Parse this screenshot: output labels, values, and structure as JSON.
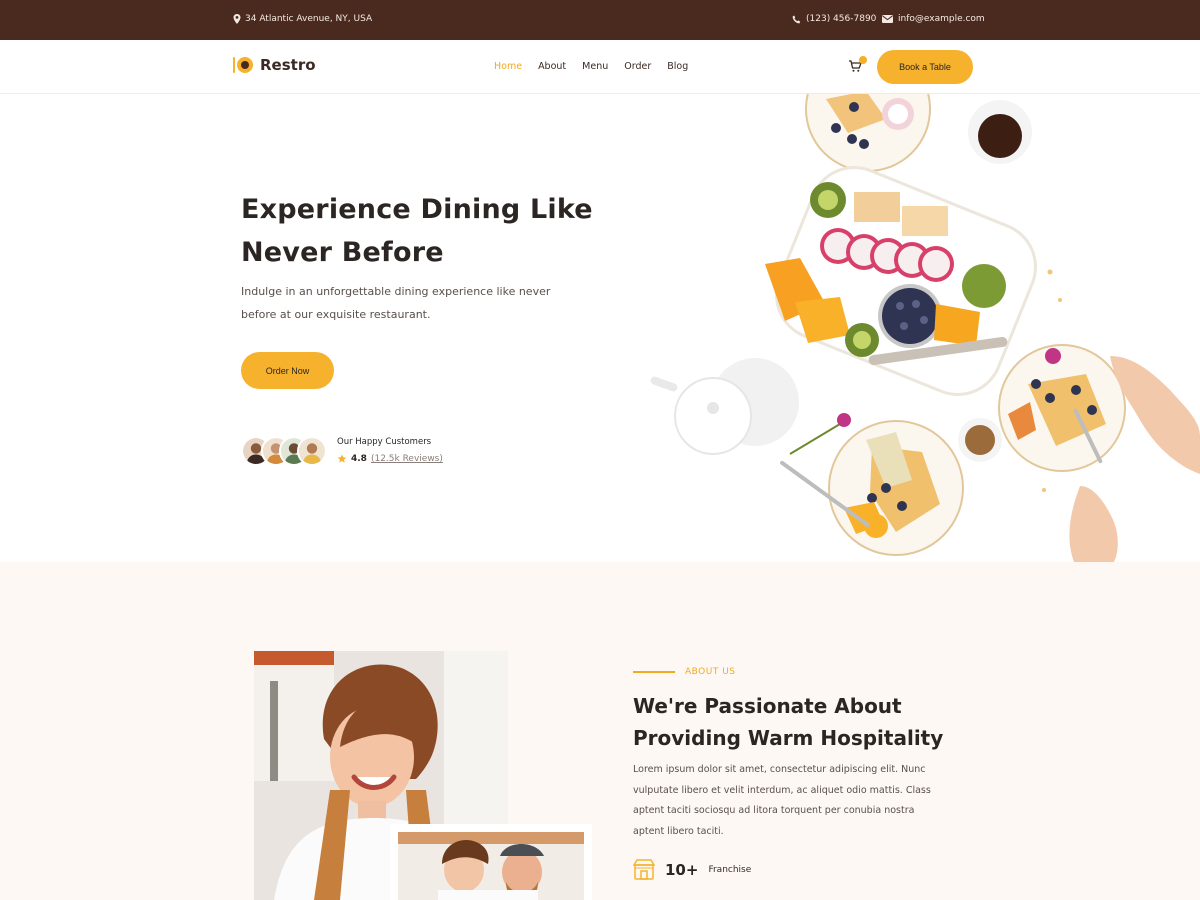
{
  "topbar": {
    "address": "34 Atlantic Avenue, NY, USA",
    "phone": "(123) 456-7890",
    "email": "info@example.com"
  },
  "header": {
    "logo_text": "Restro",
    "nav": [
      "Home",
      "About",
      "Menu",
      "Order",
      "Blog"
    ],
    "active_nav": "Home",
    "cta_label": "Book a Table"
  },
  "hero": {
    "title": "Experience Dining Like Never Before",
    "lead": "Indulge in an unforgettable dining experience like never before at our exquisite restaurant.",
    "cta_label": "Order Now",
    "customers_label": "Our Happy Customers",
    "rating": "4.8",
    "reviews": "(12.5k Reviews)"
  },
  "about": {
    "eyebrow": "ABOUT US",
    "title": "We're Passionate About Providing Warm Hospitality",
    "body": "Lorem ipsum dolor sit amet, consectetur adipiscing elit. Nunc vulputate libero et velit interdum, ac aliquet odio mattis. Class aptent taciti sociosqu ad litora torquent per conubia nostra aptent libero taciti.",
    "stat_value": "10+",
    "stat_label": "Franchise"
  },
  "colors": {
    "topbar": "#4a2a1f",
    "accent": "#f6b22d",
    "text": "#2b2523",
    "about_bg": "#fdf8f3"
  },
  "icons": [
    "location-icon",
    "phone-icon",
    "mail-icon",
    "logo-icon",
    "cart-icon",
    "star-icon",
    "franchise-icon"
  ]
}
